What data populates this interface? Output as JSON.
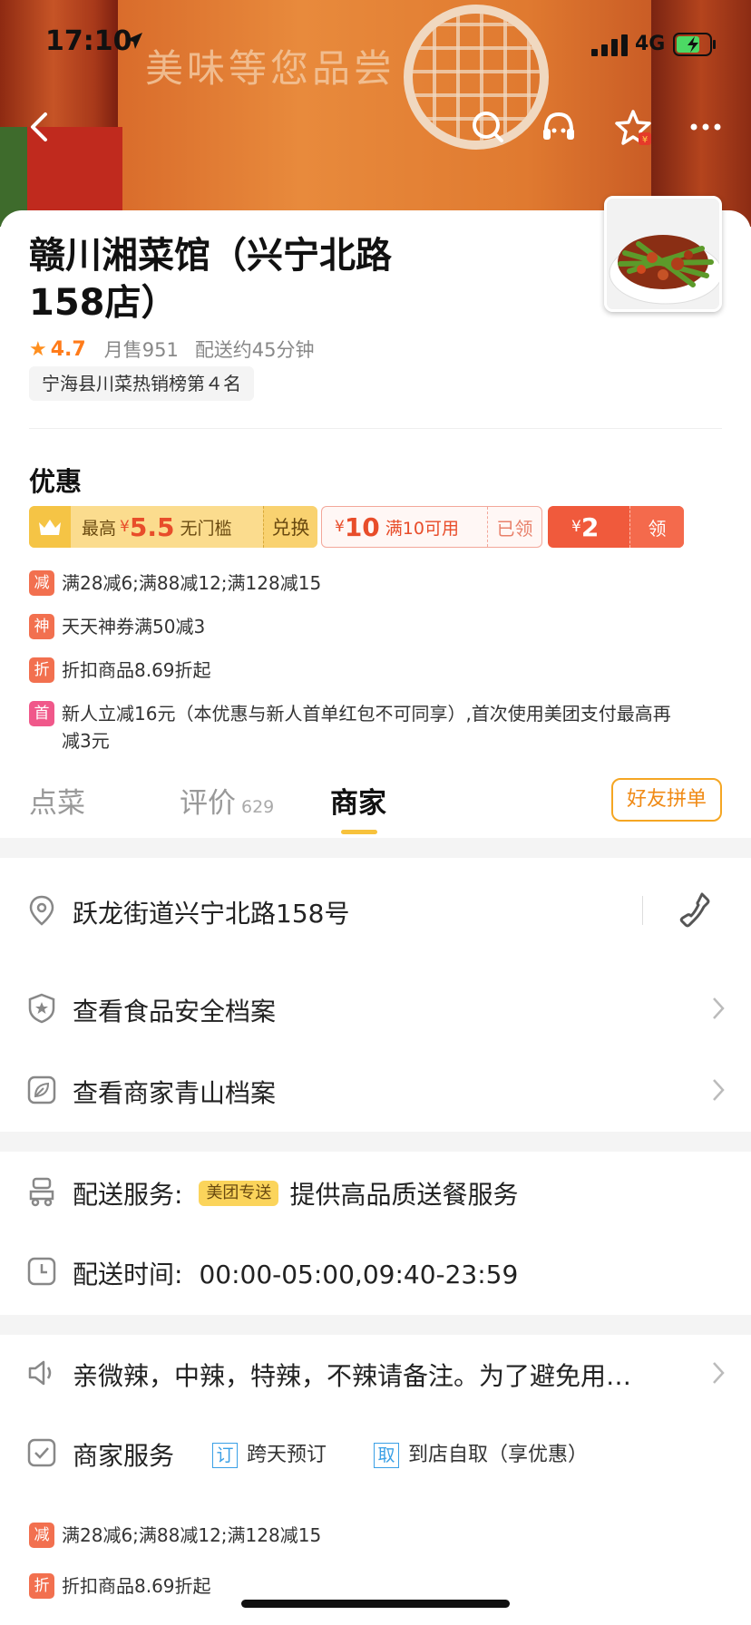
{
  "status_bar": {
    "time": "17:10",
    "network": "4G"
  },
  "banner": {
    "slogan": "美味等您品尝"
  },
  "store": {
    "name": "赣川湘菜馆（兴宁北路158店）",
    "rating": "4.7",
    "monthly_sales": "月售951",
    "delivery_time": "配送约45分钟",
    "rank": "宁海县川菜热销榜第４名"
  },
  "promotions": {
    "title": "优惠",
    "member_coupon": {
      "prefix": "最高",
      "currency": "¥",
      "amount": "5.5",
      "suffix": "无门槛",
      "action": "兑换"
    },
    "store_coupon": {
      "currency": "¥",
      "amount": "10",
      "condition": "满10可用",
      "status": "已领"
    },
    "red_packet": {
      "currency": "¥",
      "amount": "2",
      "action": "领"
    },
    "offers": [
      {
        "badge": "减",
        "color": "#f2704f",
        "text": "满28减6;满88减12;满128减15"
      },
      {
        "badge": "神",
        "color": "#f2704f",
        "text": "天天神券满50减3"
      },
      {
        "badge": "折",
        "color": "#f2704f",
        "text": "折扣商品8.69折起"
      },
      {
        "badge": "首",
        "color": "#f0588a",
        "text": "新人立减16元（本优惠与新人首单红包不可同享）,首次使用美团支付最高再减3元"
      }
    ]
  },
  "tabs": [
    {
      "label": "点菜",
      "count": ""
    },
    {
      "label": "评价",
      "count": "629"
    },
    {
      "label": "商家",
      "count": ""
    }
  ],
  "group_order_label": "好友拼单",
  "merchant": {
    "address": "跃龙街道兴宁北路158号",
    "food_safety": "查看食品安全档案",
    "green_archive": "查看商家青山档案",
    "delivery_label": "配送服务:",
    "delivery_tag": "美团专送",
    "delivery_desc": "提供高品质送餐服务",
    "hours_label": "配送时间:",
    "hours_value": "00:00-05:00,09:40-23:59",
    "notice": "亲微辣，中辣，特辣，不辣请备注。为了避免用…",
    "services_label": "商家服务",
    "services": [
      {
        "icon": "订",
        "label": "跨天预订"
      },
      {
        "icon": "取",
        "label": "到店自取（享优惠）"
      }
    ],
    "bottom_offers": [
      {
        "badge": "减",
        "text": "满28减6;满88减12;满128减15"
      },
      {
        "badge": "折",
        "text": "折扣商品8.69折起"
      }
    ]
  },
  "colors": {
    "accent_orange": "#ff7b1a",
    "coupon_red": "#f05a3c",
    "tab_indicator": "#f7c23c"
  }
}
